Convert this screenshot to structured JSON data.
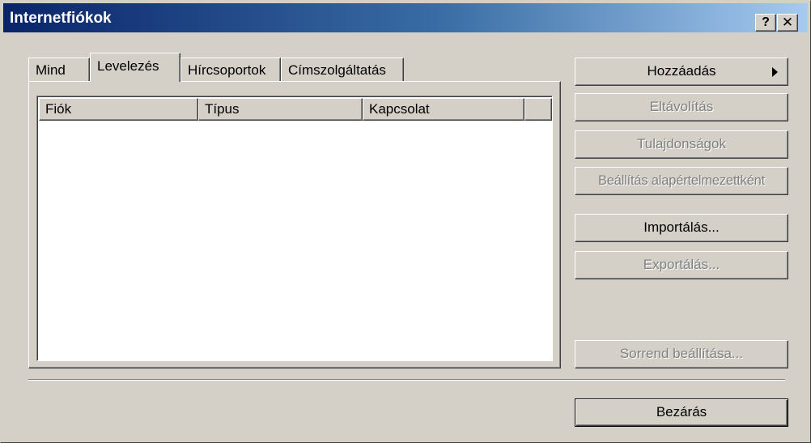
{
  "window": {
    "title": "Internetfiókok",
    "help_button": "?",
    "close_button": "✕"
  },
  "tabs": [
    {
      "label": "Mind",
      "selected": false
    },
    {
      "label": "Levelezés",
      "selected": true
    },
    {
      "label": "Hírcsoportok",
      "selected": false
    },
    {
      "label": "Címszolgáltatás",
      "selected": false
    }
  ],
  "list": {
    "columns": [
      "Fiók",
      "Típus",
      "Kapcsolat",
      ""
    ],
    "rows": []
  },
  "buttons": {
    "add": {
      "label": "Hozzáadás",
      "enabled": true
    },
    "remove": {
      "label": "Eltávolítás",
      "enabled": false
    },
    "properties": {
      "label": "Tulajdonságok",
      "enabled": false
    },
    "set_default": {
      "label": "Beállítás alapértelmezettként",
      "enabled": false
    },
    "import": {
      "label": "Importálás...",
      "enabled": true
    },
    "export": {
      "label": "Exportálás...",
      "enabled": false
    },
    "set_order": {
      "label": "Sorrend beállítása...",
      "enabled": false
    },
    "close": {
      "label": "Bezárás",
      "enabled": true
    }
  },
  "icons": {
    "add_submenu": "right-triangle-arrow"
  },
  "colors": {
    "face": "#d4d0c8",
    "titlebar_start": "#0a246a",
    "titlebar_end": "#a6caf0",
    "disabled_text": "#808080"
  }
}
